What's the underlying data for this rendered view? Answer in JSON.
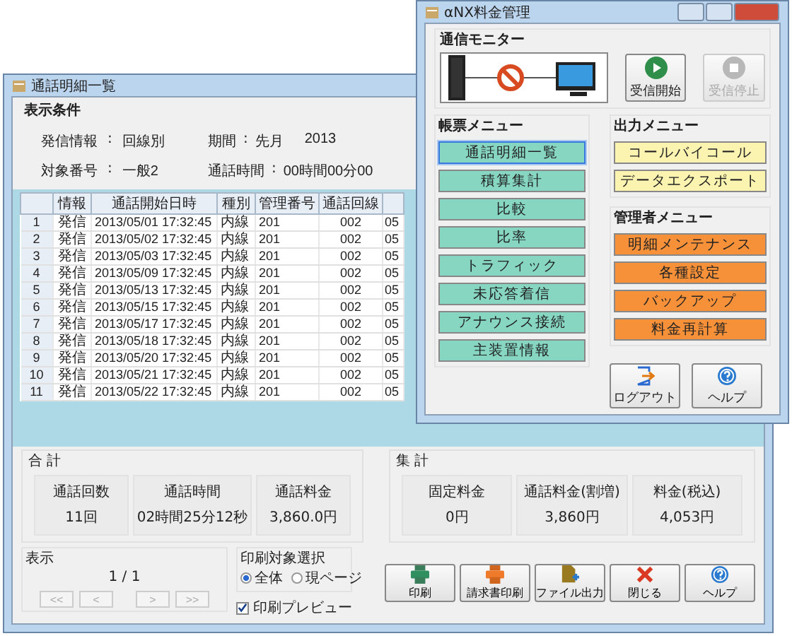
{
  "back_window": {
    "title": "通話明細一覧",
    "conditions": {
      "title": "表示条件",
      "fields": [
        {
          "label": "発信情報",
          "separator": ":",
          "value": "回線別"
        },
        {
          "label": "期間",
          "separator": ":",
          "value": "先月",
          "extra": "2013"
        },
        {
          "label": "対象番号",
          "separator": ":",
          "value": "一般2"
        },
        {
          "label": "通話時間",
          "separator": ":",
          "value": "00時間00分00"
        }
      ]
    },
    "table": {
      "columns": [
        "情報",
        "通話開始日時",
        "種別",
        "管理番号",
        "通話回線"
      ],
      "rows": [
        {
          "no": "1",
          "cells": [
            "発信",
            "2013/05/01 17:32:45",
            "内線",
            "201",
            "002",
            "05"
          ]
        },
        {
          "no": "2",
          "cells": [
            "発信",
            "2013/05/02 17:32:45",
            "内線",
            "201",
            "002",
            "05"
          ]
        },
        {
          "no": "3",
          "cells": [
            "発信",
            "2013/05/03 17:32:45",
            "内線",
            "201",
            "002",
            "05"
          ]
        },
        {
          "no": "4",
          "cells": [
            "発信",
            "2013/05/09 17:32:45",
            "内線",
            "201",
            "002",
            "05"
          ]
        },
        {
          "no": "5",
          "cells": [
            "発信",
            "2013/05/13 17:32:45",
            "内線",
            "201",
            "002",
            "05"
          ]
        },
        {
          "no": "6",
          "cells": [
            "発信",
            "2013/05/15 17:32:45",
            "内線",
            "201",
            "002",
            "05"
          ]
        },
        {
          "no": "7",
          "cells": [
            "発信",
            "2013/05/17 17:32:45",
            "内線",
            "201",
            "002",
            "05"
          ]
        },
        {
          "no": "8",
          "cells": [
            "発信",
            "2013/05/18 17:32:45",
            "内線",
            "201",
            "002",
            "05"
          ]
        },
        {
          "no": "9",
          "cells": [
            "発信",
            "2013/05/20 17:32:45",
            "内線",
            "201",
            "002",
            "05"
          ]
        },
        {
          "no": "10",
          "cells": [
            "発信",
            "2013/05/21 17:32:45",
            "内線",
            "201",
            "002",
            "05"
          ]
        },
        {
          "no": "11",
          "cells": [
            "発信",
            "2013/05/22 17:32:45",
            "内線",
            "201",
            "002",
            "05"
          ]
        }
      ]
    },
    "totals": {
      "title": "合 計",
      "items": [
        {
          "label": "通話回数",
          "value": "11回"
        },
        {
          "label": "通話時間",
          "value": "02時間25分12秒"
        },
        {
          "label": "通話料金",
          "value": "3,860.0円"
        }
      ]
    },
    "summary": {
      "title": "集 計",
      "items": [
        {
          "label": "固定料金",
          "value": "0円"
        },
        {
          "label": "通話料金(割増)",
          "value": "3,860円"
        },
        {
          "label": "料金(税込)",
          "value": "4,053円"
        }
      ]
    },
    "display": {
      "title": "表示",
      "page": "1 / 1",
      "nav": [
        "<<",
        "<",
        ">",
        ">>"
      ]
    },
    "print_target": {
      "title": "印刷対象選択",
      "options": [
        {
          "label": "全体",
          "selected": true
        },
        {
          "label": "現ページ",
          "selected": false
        }
      ]
    },
    "preview": {
      "label": "印刷プレビュー",
      "checked": true
    },
    "buttons": [
      {
        "label": "印刷",
        "kind": "printer"
      },
      {
        "label": "請求書印刷",
        "kind": "invoice"
      },
      {
        "label": "ファイル出力",
        "kind": "file"
      },
      {
        "label": "閉じる",
        "kind": "close"
      },
      {
        "label": "ヘルプ",
        "kind": "help"
      }
    ]
  },
  "front_window": {
    "title": "αNX料金管理",
    "monitor": {
      "title": "通信モニター",
      "buttons": [
        {
          "label": "受信開始",
          "kind": "play",
          "disabled": false
        },
        {
          "label": "受信停止",
          "kind": "stop",
          "disabled": true
        }
      ]
    },
    "menus": [
      {
        "kind": "report",
        "title": "帳票メニュー",
        "items": [
          {
            "label": "通話明細一覧",
            "selected": true
          },
          {
            "label": "積算集計",
            "selected": false
          },
          {
            "label": "比較",
            "selected": false
          },
          {
            "label": "比率",
            "selected": false
          },
          {
            "label": "トラフィック",
            "selected": false
          },
          {
            "label": "未応答着信",
            "selected": false
          },
          {
            "label": "アナウンス接続",
            "selected": false
          },
          {
            "label": "主装置情報",
            "selected": false
          }
        ]
      },
      {
        "kind": "output",
        "title": "出力メニュー",
        "items": [
          {
            "label": "コールバイコール",
            "selected": false
          },
          {
            "label": "データエクスポート",
            "selected": false
          }
        ]
      },
      {
        "kind": "admin",
        "title": "管理者メニュー",
        "items": [
          {
            "label": "明細メンテナンス",
            "selected": false
          },
          {
            "label": "各種設定",
            "selected": false
          },
          {
            "label": "バックアップ",
            "selected": false
          },
          {
            "label": "料金再計算",
            "selected": false
          }
        ]
      }
    ],
    "buttons": [
      {
        "label": "ログアウト",
        "kind": "logout"
      },
      {
        "label": "ヘルプ",
        "kind": "help"
      }
    ]
  }
}
